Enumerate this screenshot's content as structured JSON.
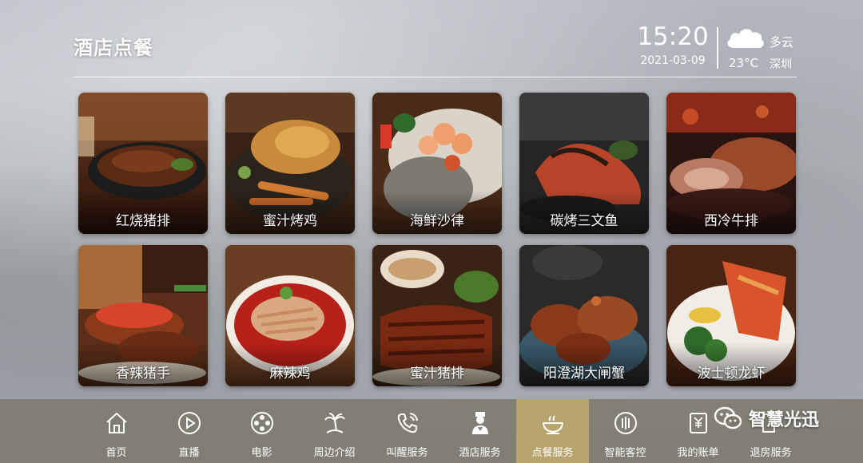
{
  "header": {
    "title": "酒店点餐",
    "time": "15:20",
    "date": "2021-03-09",
    "weather": "多云",
    "temperature": "23°C",
    "city": "深圳"
  },
  "menu": {
    "items": [
      {
        "name": "红烧猪排"
      },
      {
        "name": "蜜汁烤鸡"
      },
      {
        "name": "海鲜沙律"
      },
      {
        "name": "碳烤三文鱼"
      },
      {
        "name": "西冷牛排"
      },
      {
        "name": "香辣猪手"
      },
      {
        "name": "麻辣鸡"
      },
      {
        "name": "蜜汁猪排"
      },
      {
        "name": "阳澄湖大闸蟹"
      },
      {
        "name": "波士顿龙虾"
      }
    ]
  },
  "nav": {
    "active": "点餐服务",
    "items": [
      {
        "label": "首页",
        "icon": "home-icon"
      },
      {
        "label": "直播",
        "icon": "play-icon"
      },
      {
        "label": "电影",
        "icon": "film-reel-icon"
      },
      {
        "label": "周边介绍",
        "icon": "palm-tree-icon"
      },
      {
        "label": "叫醒服务",
        "icon": "phone-call-icon"
      },
      {
        "label": "酒店服务",
        "icon": "waiter-icon"
      },
      {
        "label": "点餐服务",
        "icon": "food-bowl-icon"
      },
      {
        "label": "智能客控",
        "icon": "smart-control-icon"
      },
      {
        "label": "我的账单",
        "icon": "bill-icon"
      },
      {
        "label": "退房服务",
        "icon": "checkout-icon"
      }
    ]
  },
  "watermark": {
    "text": "智慧光迅",
    "icon": "wechat-icon"
  },
  "colors": {
    "nav_background": "#7a7564",
    "nav_active": "#b8a46e",
    "text": "#ffffff"
  }
}
